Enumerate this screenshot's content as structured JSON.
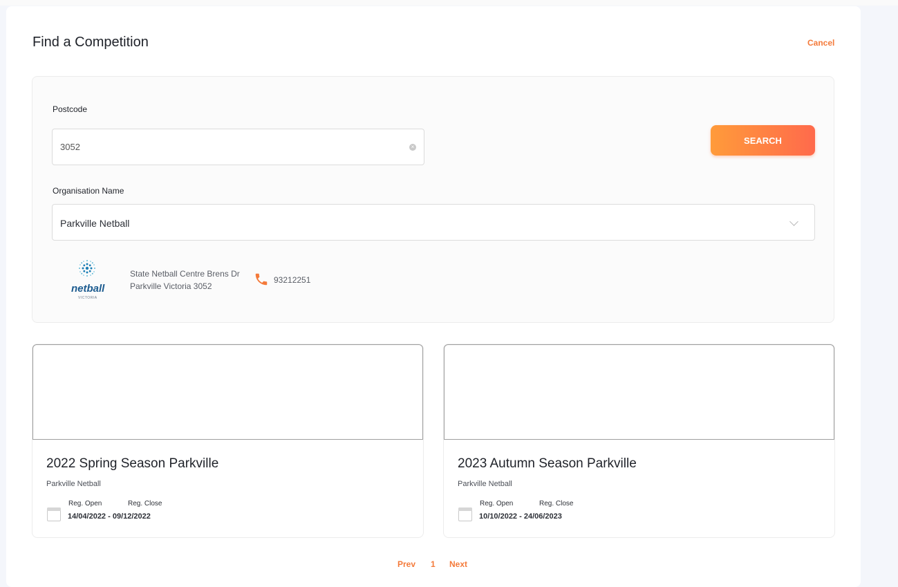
{
  "page": {
    "title": "Find a Competition",
    "cancel_label": "Cancel"
  },
  "search": {
    "postcode_label": "Postcode",
    "postcode_value": "3052",
    "org_label": "Organisation Name",
    "org_value": "Parkville Netball",
    "search_button": "SEARCH"
  },
  "organisation": {
    "logo_text": "netball",
    "logo_sub": "VICTORIA",
    "address": "State Netball Centre Brens Dr Parkville Victoria 3052",
    "phone": "93212251"
  },
  "competitions": [
    {
      "name": "2022 Spring Season Parkville",
      "org": "Parkville Netball",
      "reg_open_label": "Reg. Open",
      "reg_close_label": "Reg. Close",
      "dates": "14/04/2022  - 09/12/2022"
    },
    {
      "name": "2023 Autumn Season Parkville",
      "org": "Parkville Netball",
      "reg_open_label": "Reg. Open",
      "reg_close_label": "Reg. Close",
      "dates": "10/10/2022  - 24/06/2023"
    }
  ],
  "pagination": {
    "prev": "Prev",
    "current": "1",
    "next": "Next"
  },
  "colors": {
    "accent": "#f47a3a",
    "button_gradient_start": "#ff9b3a",
    "button_gradient_end": "#ff6a4c"
  }
}
